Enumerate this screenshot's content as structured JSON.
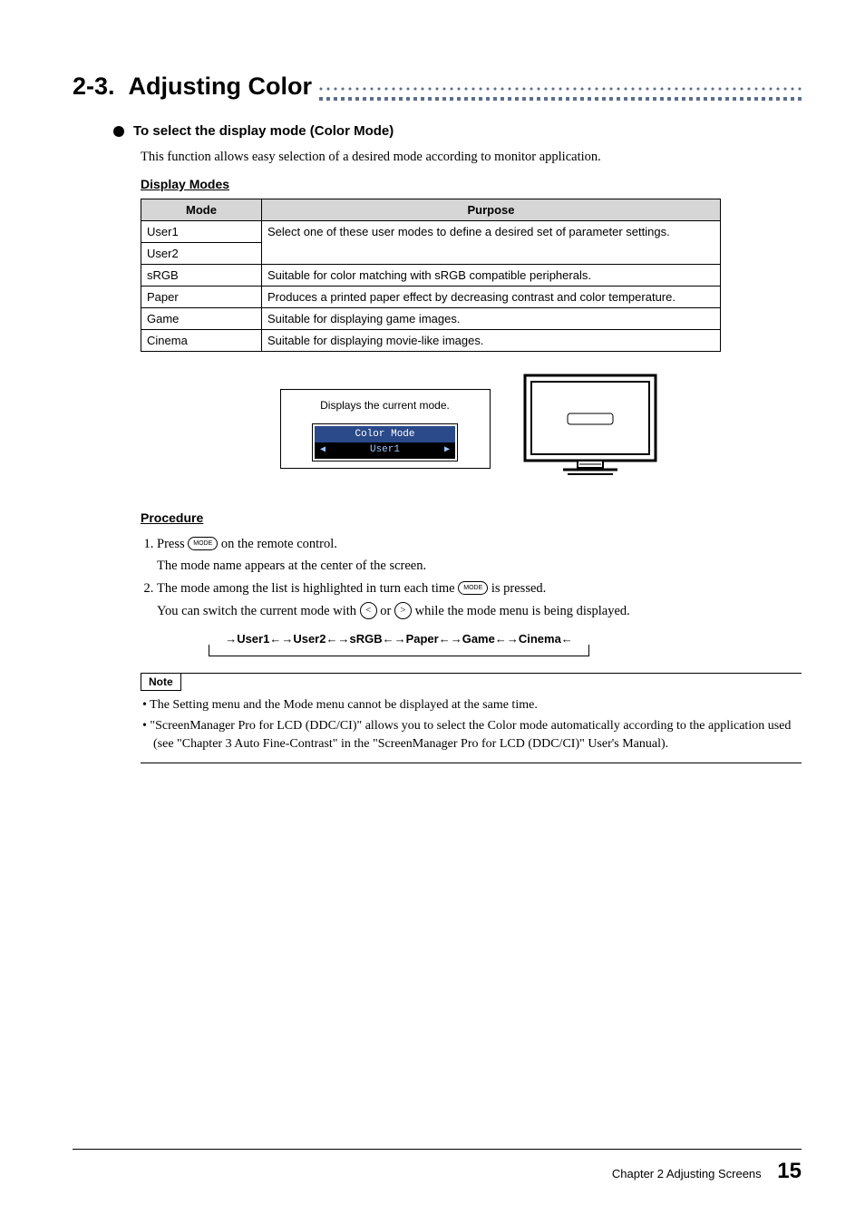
{
  "section": {
    "number": "2-3.",
    "title": "Adjusting Color"
  },
  "subhead1": "To select the display mode (Color Mode)",
  "intro": "This function allows easy selection of a desired mode according to monitor application.",
  "display_modes_label": "Display Modes",
  "table": {
    "headers": [
      "Mode",
      "Purpose"
    ],
    "rows": [
      {
        "mode": "User1",
        "purpose_rowspan_start": true
      },
      {
        "mode": "User2",
        "purpose": "Select one of these user modes to define a desired set of parameter settings."
      },
      {
        "mode": "sRGB",
        "purpose": "Suitable for color matching with sRGB compatible peripherals."
      },
      {
        "mode": "Paper",
        "purpose": "Produces a printed paper effect by decreasing contrast and color temperature."
      },
      {
        "mode": "Game",
        "purpose": "Suitable for displaying game images."
      },
      {
        "mode": "Cinema",
        "purpose": "Suitable for displaying movie-like images."
      }
    ]
  },
  "figure": {
    "callout": "Displays the current mode.",
    "osd_title": "Color Mode",
    "osd_value": "User1"
  },
  "procedure_label": "Procedure",
  "procedure": {
    "step1_a": "Press ",
    "step1_b": " on the remote control.",
    "step1_btn": "MODE",
    "step1_sub": "The mode name appears at the center of the screen.",
    "step2_a": "The mode among the list is highlighted in turn each time ",
    "step2_b": " is pressed.",
    "step2_btn": "MODE",
    "step2_sub_a": "You can switch the current mode with ",
    "step2_sub_mid": " or ",
    "step2_sub_b": " while the mode menu is being displayed.",
    "left_glyph": "<",
    "right_glyph": ">"
  },
  "cycle": "→User1←→User2←→sRGB←→Paper←→Game←→Cinema←",
  "note_label": "Note",
  "notes": [
    "The Setting menu and the Mode menu cannot be displayed at the same time.",
    "\"ScreenManager Pro for LCD (DDC/CI)\" allows you to select the Color mode automatically according to the application used (see \"Chapter 3 Auto Fine-Contrast\" in the \"ScreenManager Pro for LCD (DDC/CI)\" User's Manual)."
  ],
  "footer": {
    "chapter": "Chapter 2 Adjusting Screens",
    "page": "15"
  }
}
